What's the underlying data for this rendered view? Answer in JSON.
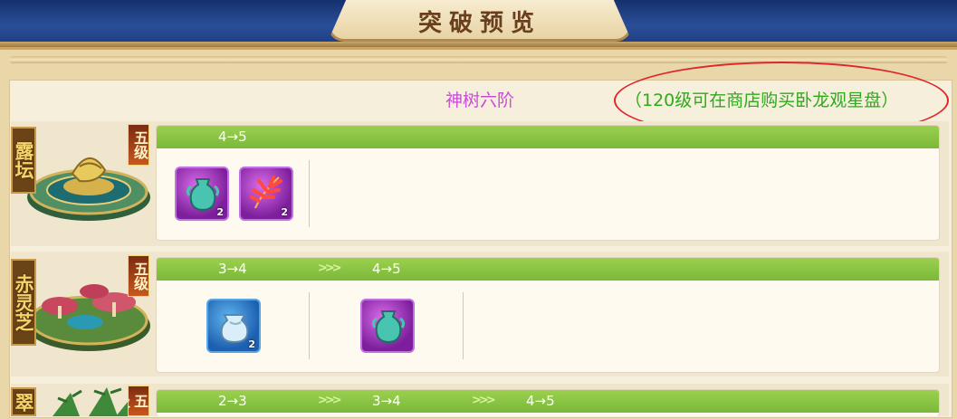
{
  "header": {
    "title": "突破预览"
  },
  "info": {
    "tree_stage": "神树六阶",
    "shop_note": "（120级可在商店购买卧龙观星盘）"
  },
  "rows": [
    {
      "name": "露坛",
      "level": "五级",
      "stages": [
        {
          "label": "4→5",
          "items": [
            {
              "icon": "turquoise-vase-icon",
              "count": "2",
              "rarity_color": "#9b33c0"
            },
            {
              "icon": "red-coral-leaf-icon",
              "count": "2",
              "rarity_color": "#9b33c0"
            }
          ]
        }
      ]
    },
    {
      "name": "赤灵芝",
      "level": "五级",
      "stages": [
        {
          "label": "3→4",
          "items": [
            {
              "icon": "blue-vase-icon",
              "count": "2",
              "rarity_color": "#2a6fc0"
            }
          ]
        },
        {
          "label": "4→5",
          "items": [
            {
              "icon": "turquoise-vase-icon",
              "count": "",
              "rarity_color": "#9b33c0"
            }
          ]
        }
      ]
    },
    {
      "name": "翠",
      "level": "五级",
      "stages": [
        {
          "label": "2→3",
          "items": []
        },
        {
          "label": "3→4",
          "items": []
        },
        {
          "label": "4→5",
          "items": []
        }
      ]
    }
  ],
  "colors": {
    "accent_green": "#2eaa1b",
    "tree_stage_purple": "#c94bd6",
    "highlight_red": "#e0262d",
    "bar_green": "#8cc546"
  }
}
